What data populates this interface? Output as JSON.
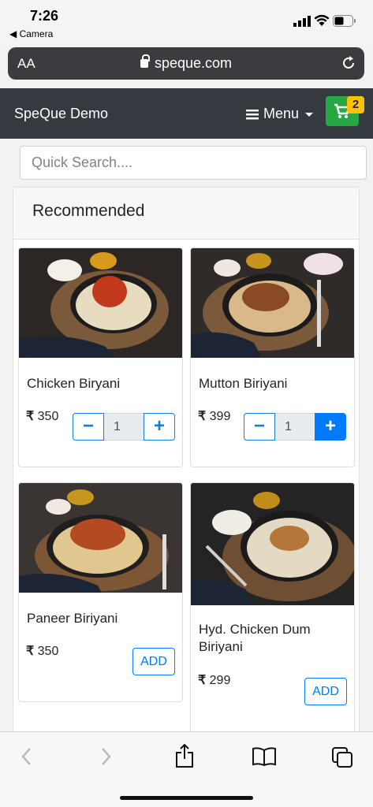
{
  "status": {
    "time": "7:26",
    "back_app": "Camera"
  },
  "browser": {
    "aa": "AA",
    "url": "speque.com"
  },
  "navbar": {
    "brand": "SpeQue Demo",
    "menu_label": "Menu",
    "cart_count": "2"
  },
  "search": {
    "placeholder": "Quick Search...."
  },
  "section": {
    "title": "Recommended"
  },
  "items": [
    {
      "name": "Chicken Biryani",
      "currency": "₹",
      "price": "350",
      "qty": "1",
      "has_stepper": true
    },
    {
      "name": "Mutton Biriyani",
      "currency": "₹",
      "price": "399",
      "qty": "1",
      "has_stepper": true
    },
    {
      "name": "Paneer Biriyani",
      "currency": "₹",
      "price": "350",
      "add_label": "ADD"
    },
    {
      "name": "Hyd. Chicken Dum Biriyani",
      "currency": "₹",
      "price": "299",
      "add_label": "ADD"
    }
  ],
  "colors": {
    "navbar": "#343a40",
    "cart": "#28a745",
    "badge": "#ffc107",
    "primary": "#007bff"
  },
  "toolbar_icons": [
    "back-arrow-icon",
    "forward-arrow-icon",
    "share-icon",
    "bookmarks-icon",
    "tabs-icon"
  ]
}
